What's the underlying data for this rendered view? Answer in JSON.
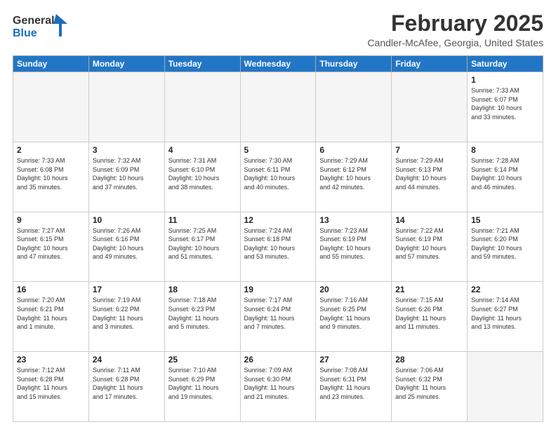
{
  "logo": {
    "line1": "General",
    "line2": "Blue"
  },
  "title": "February 2025",
  "subtitle": "Candler-McAfee, Georgia, United States",
  "days_of_week": [
    "Sunday",
    "Monday",
    "Tuesday",
    "Wednesday",
    "Thursday",
    "Friday",
    "Saturday"
  ],
  "weeks": [
    [
      {
        "day": "",
        "info": ""
      },
      {
        "day": "",
        "info": ""
      },
      {
        "day": "",
        "info": ""
      },
      {
        "day": "",
        "info": ""
      },
      {
        "day": "",
        "info": ""
      },
      {
        "day": "",
        "info": ""
      },
      {
        "day": "1",
        "info": "Sunrise: 7:33 AM\nSunset: 6:07 PM\nDaylight: 10 hours\nand 33 minutes."
      }
    ],
    [
      {
        "day": "2",
        "info": "Sunrise: 7:33 AM\nSunset: 6:08 PM\nDaylight: 10 hours\nand 35 minutes."
      },
      {
        "day": "3",
        "info": "Sunrise: 7:32 AM\nSunset: 6:09 PM\nDaylight: 10 hours\nand 37 minutes."
      },
      {
        "day": "4",
        "info": "Sunrise: 7:31 AM\nSunset: 6:10 PM\nDaylight: 10 hours\nand 38 minutes."
      },
      {
        "day": "5",
        "info": "Sunrise: 7:30 AM\nSunset: 6:11 PM\nDaylight: 10 hours\nand 40 minutes."
      },
      {
        "day": "6",
        "info": "Sunrise: 7:29 AM\nSunset: 6:12 PM\nDaylight: 10 hours\nand 42 minutes."
      },
      {
        "day": "7",
        "info": "Sunrise: 7:29 AM\nSunset: 6:13 PM\nDaylight: 10 hours\nand 44 minutes."
      },
      {
        "day": "8",
        "info": "Sunrise: 7:28 AM\nSunset: 6:14 PM\nDaylight: 10 hours\nand 46 minutes."
      }
    ],
    [
      {
        "day": "9",
        "info": "Sunrise: 7:27 AM\nSunset: 6:15 PM\nDaylight: 10 hours\nand 47 minutes."
      },
      {
        "day": "10",
        "info": "Sunrise: 7:26 AM\nSunset: 6:16 PM\nDaylight: 10 hours\nand 49 minutes."
      },
      {
        "day": "11",
        "info": "Sunrise: 7:25 AM\nSunset: 6:17 PM\nDaylight: 10 hours\nand 51 minutes."
      },
      {
        "day": "12",
        "info": "Sunrise: 7:24 AM\nSunset: 6:18 PM\nDaylight: 10 hours\nand 53 minutes."
      },
      {
        "day": "13",
        "info": "Sunrise: 7:23 AM\nSunset: 6:19 PM\nDaylight: 10 hours\nand 55 minutes."
      },
      {
        "day": "14",
        "info": "Sunrise: 7:22 AM\nSunset: 6:19 PM\nDaylight: 10 hours\nand 57 minutes."
      },
      {
        "day": "15",
        "info": "Sunrise: 7:21 AM\nSunset: 6:20 PM\nDaylight: 10 hours\nand 59 minutes."
      }
    ],
    [
      {
        "day": "16",
        "info": "Sunrise: 7:20 AM\nSunset: 6:21 PM\nDaylight: 11 hours\nand 1 minute."
      },
      {
        "day": "17",
        "info": "Sunrise: 7:19 AM\nSunset: 6:22 PM\nDaylight: 11 hours\nand 3 minutes."
      },
      {
        "day": "18",
        "info": "Sunrise: 7:18 AM\nSunset: 6:23 PM\nDaylight: 11 hours\nand 5 minutes."
      },
      {
        "day": "19",
        "info": "Sunrise: 7:17 AM\nSunset: 6:24 PM\nDaylight: 11 hours\nand 7 minutes."
      },
      {
        "day": "20",
        "info": "Sunrise: 7:16 AM\nSunset: 6:25 PM\nDaylight: 11 hours\nand 9 minutes."
      },
      {
        "day": "21",
        "info": "Sunrise: 7:15 AM\nSunset: 6:26 PM\nDaylight: 11 hours\nand 11 minutes."
      },
      {
        "day": "22",
        "info": "Sunrise: 7:14 AM\nSunset: 6:27 PM\nDaylight: 11 hours\nand 13 minutes."
      }
    ],
    [
      {
        "day": "23",
        "info": "Sunrise: 7:12 AM\nSunset: 6:28 PM\nDaylight: 11 hours\nand 15 minutes."
      },
      {
        "day": "24",
        "info": "Sunrise: 7:11 AM\nSunset: 6:28 PM\nDaylight: 11 hours\nand 17 minutes."
      },
      {
        "day": "25",
        "info": "Sunrise: 7:10 AM\nSunset: 6:29 PM\nDaylight: 11 hours\nand 19 minutes."
      },
      {
        "day": "26",
        "info": "Sunrise: 7:09 AM\nSunset: 6:30 PM\nDaylight: 11 hours\nand 21 minutes."
      },
      {
        "day": "27",
        "info": "Sunrise: 7:08 AM\nSunset: 6:31 PM\nDaylight: 11 hours\nand 23 minutes."
      },
      {
        "day": "28",
        "info": "Sunrise: 7:06 AM\nSunset: 6:32 PM\nDaylight: 11 hours\nand 25 minutes."
      },
      {
        "day": "",
        "info": ""
      }
    ]
  ]
}
